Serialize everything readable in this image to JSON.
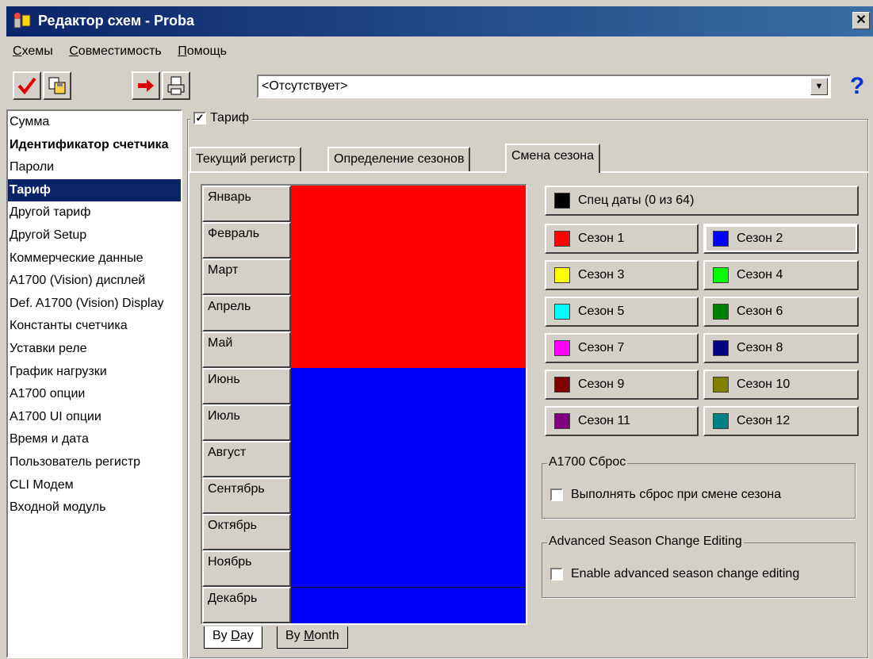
{
  "window": {
    "title": "Редактор схем - Proba",
    "close_icon": "close-icon"
  },
  "menu": [
    {
      "prefix": "",
      "accel": "С",
      "rest": "хемы"
    },
    {
      "prefix": "",
      "accel": "С",
      "rest": "овместимость"
    },
    {
      "prefix": "",
      "accel": "П",
      "rest": "омощь"
    }
  ],
  "toolbar": {
    "combo_value": "<Отсутствует>",
    "help_label": "?"
  },
  "left_list": {
    "items": [
      "Сумма",
      "Идентификатор счетчика",
      "Пароли",
      "Тариф",
      "Другой тариф",
      "Другой Setup",
      "Коммерческие данные",
      "A1700 (Vision) дисплей",
      "Def. A1700 (Vision) Display",
      "Константы счетчика",
      "Уставки реле",
      "График нагрузки",
      "A1700 опции",
      "A1700 UI опции",
      "Время и дата",
      "Пользователь регистр",
      "CLI Модем",
      "Входной модуль"
    ],
    "selected": "Тариф"
  },
  "tarif": {
    "checkbox_label": "Тариф",
    "checked": true
  },
  "tabs": [
    "Текущий регистр",
    "Определение сезонов",
    "Смена сезона"
  ],
  "active_tab": "Смена сезона",
  "months": [
    "Январь",
    "Февраль",
    "Март",
    "Апрель",
    "Май",
    "Июнь",
    "Июль",
    "Август",
    "Сентябрь",
    "Октябрь",
    "Ноябрь",
    "Декабрь"
  ],
  "season_assignment": {
    "Январь": "Сезон 1",
    "Февраль": "Сезон 1",
    "Март": "Сезон 1",
    "Апрель": "Сезон 1",
    "Май": "Сезон 1",
    "Июнь": "Сезон 2",
    "Июль": "Сезон 2",
    "Август": "Сезон 2",
    "Сентябрь": "Сезон 2",
    "Октябрь": "Сезон 2",
    "Ноябрь": "Сезон 2",
    "Декабрь": "Сезон 2"
  },
  "view_tabs": {
    "by_day": {
      "prefix": "By ",
      "accel": "D",
      "rest": "ay"
    },
    "by_month": {
      "prefix": "By ",
      "accel": "M",
      "rest": "onth"
    },
    "active": "By Day"
  },
  "spec_dates": {
    "label": "Спец даты (0 из 64)",
    "color": "#000000"
  },
  "seasons": [
    {
      "label": "Сезон 1",
      "color": "#ff0000"
    },
    {
      "label": "Сезон 2",
      "color": "#0000ff"
    },
    {
      "label": "Сезон 3",
      "color": "#ffff00"
    },
    {
      "label": "Сезон 4",
      "color": "#00ff00"
    },
    {
      "label": "Сезон 5",
      "color": "#00ffff"
    },
    {
      "label": "Сезон 6",
      "color": "#008000"
    },
    {
      "label": "Сезон 7",
      "color": "#ff00ff"
    },
    {
      "label": "Сезон 8",
      "color": "#000080"
    },
    {
      "label": "Сезон 9",
      "color": "#800000"
    },
    {
      "label": "Сезон 10",
      "color": "#808000"
    },
    {
      "label": "Сезон 11",
      "color": "#800080"
    },
    {
      "label": "Сезон 12",
      "color": "#008080"
    }
  ],
  "selected_season": "Сезон 2",
  "a1700_reset": {
    "title": "A1700 Сброс",
    "checkbox_label": "Выполнять сброс при смене сезона",
    "checked": false
  },
  "advanced": {
    "title": "Advanced Season Change Editing",
    "checkbox_label": "Enable advanced season change editing",
    "checked": false
  }
}
